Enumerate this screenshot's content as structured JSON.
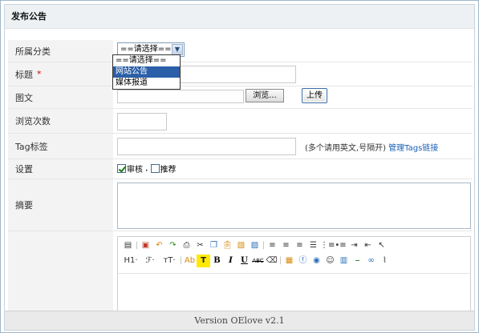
{
  "panel": {
    "title": "发布公告"
  },
  "form": {
    "category": {
      "label": "所属分类",
      "selected": "==请选择==",
      "options": [
        "==请选择==",
        "网站公告",
        "媒体报道"
      ],
      "highlighted_option": "网站公告"
    },
    "title": {
      "label": "标题",
      "required_mark": "*",
      "value": ""
    },
    "image": {
      "label": "图文",
      "value": "",
      "browse_label": "浏览...",
      "upload_label": "上传"
    },
    "views": {
      "label": "浏览次数",
      "value": ""
    },
    "tags": {
      "label": "Tag标签",
      "value": "",
      "hint": "(多个请用英文,号隔开)",
      "manage_link": "管理Tags链接"
    },
    "settings": {
      "label": "设置",
      "audit": {
        "label": "审核",
        "checked": true
      },
      "separator": ",",
      "recommend": {
        "label": "推荐",
        "checked": false
      }
    },
    "summary": {
      "label": "摘要",
      "value": ""
    },
    "content": {
      "label": ""
    }
  },
  "editor": {
    "toolbar_row1": [
      "source-icon",
      "|",
      "template-icon",
      "undo-icon",
      "redo-icon",
      "print-icon",
      "cut-icon",
      "copy-icon",
      "paste-icon",
      "paste-text-icon",
      "paste-word-icon",
      "|",
      "align-left-icon",
      "align-center-icon",
      "align-right-icon",
      "justify-icon",
      "ordered-list-icon",
      "unordered-list-icon",
      "indent-icon",
      "outdent-icon",
      "select-icon"
    ],
    "toolbar_row2": {
      "heading": "H1·",
      "font": "ℱ·",
      "font_size": "тT·",
      "color": "Ab",
      "highlight": "T",
      "bold": "B",
      "italic": "I",
      "underline": "U",
      "strike": "ABC",
      "eraser_icon": "eraser-icon",
      "image_icon": "image-icon",
      "flash_icon": "flash-icon",
      "media_icon": "media-icon",
      "emoticon_icon": "emoticon-icon",
      "table_icon": "table-icon",
      "hr_icon": "hr-icon",
      "link_icon": "link-icon",
      "unlink_icon": "unlink-icon"
    }
  },
  "footer": {
    "text": "Version OElove v2.1"
  }
}
